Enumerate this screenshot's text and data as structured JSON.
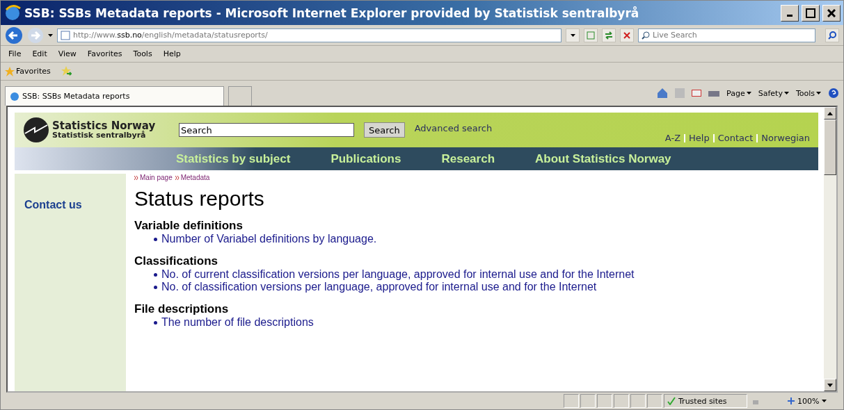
{
  "window": {
    "title": "SSB: SSBs Metadata reports - Microsoft Internet Explorer provided by Statistisk sentralbyrå"
  },
  "address_bar": {
    "url_host_prefix": "http://www.",
    "url_host": "ssb.no",
    "url_path": "/english/metadata/statusreports/"
  },
  "live_search": {
    "placeholder": "Live Search"
  },
  "menu": [
    "File",
    "Edit",
    "View",
    "Favorites",
    "Tools",
    "Help"
  ],
  "favorites_bar": {
    "label": "Favorites"
  },
  "tabs": [
    {
      "label": "SSB: SSBs Metadata reports",
      "selected": true
    }
  ],
  "command_bar": [
    "Page",
    "Safety",
    "Tools"
  ],
  "site": {
    "logo_title": "Statistics Norway",
    "logo_subtitle": "Statistisk sentralbyrå",
    "search_value": "Search",
    "search_button": "Search",
    "advanced_search": "Advanced search",
    "top_links": [
      "A-Z",
      "Help",
      "Contact",
      "Norwegian"
    ],
    "nav": [
      "Statistics by subject",
      "Publications",
      "Research",
      "About Statistics Norway"
    ],
    "breadcrumb": [
      "Main page",
      "Metadata"
    ],
    "sidebar": [
      "Contact us"
    ],
    "heading": "Status reports",
    "sections": [
      {
        "title": "Variable definitions",
        "links": [
          "Number of Variabel definitions by language."
        ]
      },
      {
        "title": "Classifications",
        "links": [
          "No. of current classification versions per language, approved for internal use and for the Internet",
          "No. of classification versions per language, approved for internal use and for the Internet"
        ]
      },
      {
        "title": "File descriptions",
        "links": [
          "The number of file descriptions"
        ]
      }
    ]
  },
  "status_bar": {
    "zone": "Trusted sites",
    "zoom": "100%"
  }
}
